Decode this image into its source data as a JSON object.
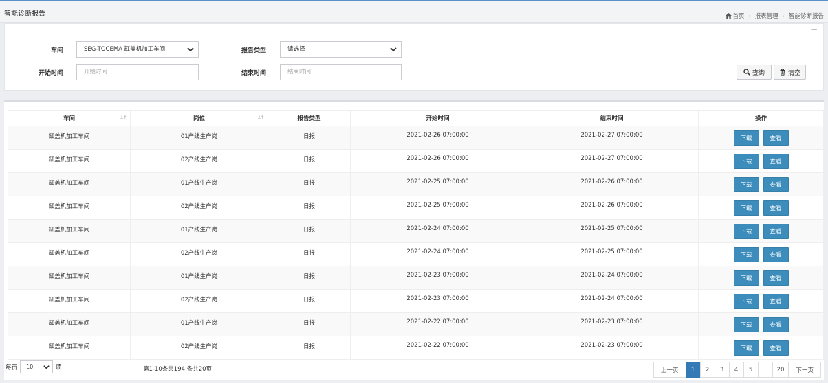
{
  "header": {
    "title": "智能诊断报告",
    "breadcrumb": [
      "首页",
      "报表管理",
      "智能诊断报告"
    ]
  },
  "filters": {
    "workshop_label": "车间",
    "workshop_value": "SEG-TOCEMA 缸盖机加工车间",
    "report_type_label": "报告类型",
    "report_type_value": "请选择",
    "start_label": "开始时间",
    "start_placeholder": "开始时间",
    "end_label": "结束时间",
    "end_placeholder": "结束时间",
    "query_label": "查询",
    "clear_label": "清空",
    "collapse": "−"
  },
  "table": {
    "columns": [
      "车间",
      "岗位",
      "报告类型",
      "开始时间",
      "结束时间",
      "操作"
    ],
    "rows": [
      [
        "缸盖机加工车间",
        "01产线生产岗",
        "日报",
        "2021-02-26 07:00:00",
        "2021-02-27 07:00:00"
      ],
      [
        "缸盖机加工车间",
        "02产线生产岗",
        "日报",
        "2021-02-26 07:00:00",
        "2021-02-27 07:00:00"
      ],
      [
        "缸盖机加工车间",
        "01产线生产岗",
        "日报",
        "2021-02-25 07:00:00",
        "2021-02-26 07:00:00"
      ],
      [
        "缸盖机加工车间",
        "02产线生产岗",
        "日报",
        "2021-02-25 07:00:00",
        "2021-02-26 07:00:00"
      ],
      [
        "缸盖机加工车间",
        "01产线生产岗",
        "日报",
        "2021-02-24 07:00:00",
        "2021-02-25 07:00:00"
      ],
      [
        "缸盖机加工车间",
        "02产线生产岗",
        "日报",
        "2021-02-24 07:00:00",
        "2021-02-25 07:00:00"
      ],
      [
        "缸盖机加工车间",
        "01产线生产岗",
        "日报",
        "2021-02-23 07:00:00",
        "2021-02-24 07:00:00"
      ],
      [
        "缸盖机加工车间",
        "02产线生产岗",
        "日报",
        "2021-02-23 07:00:00",
        "2021-02-24 07:00:00"
      ],
      [
        "缸盖机加工车间",
        "01产线生产岗",
        "日报",
        "2021-02-22 07:00:00",
        "2021-02-23 07:00:00"
      ],
      [
        "缸盖机加工车间",
        "02产线生产岗",
        "日报",
        "2021-02-22 07:00:00",
        "2021-02-23 07:00:00"
      ]
    ],
    "download_label": "下载",
    "view_label": "查看"
  },
  "footer": {
    "per_page_prefix": "每页",
    "per_page_value": "10",
    "per_page_suffix": "项",
    "summary": "第1-10条共194 条共20页",
    "pages": [
      "上一页",
      "1",
      "2",
      "3",
      "4",
      "5",
      "...",
      "20",
      "下一页"
    ],
    "active_page": "1"
  },
  "colors": {
    "accent": "#3c8dbc",
    "active_page": "#337ab7"
  }
}
